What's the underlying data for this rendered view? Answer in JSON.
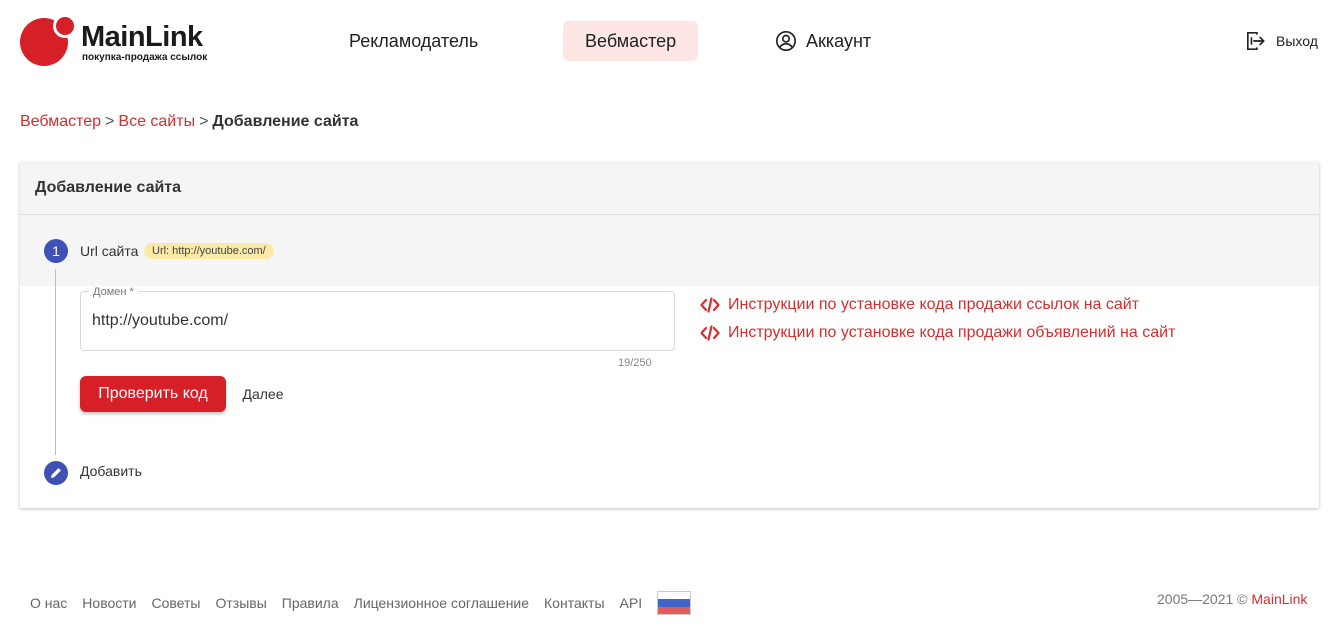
{
  "logo": {
    "name": "MainLink",
    "tagline": "покупка-продажа ссылок"
  },
  "nav": {
    "advertiser": "Рекламодатель",
    "webmaster": "Вебмастер",
    "account": "Аккаунт",
    "logout": "Выход"
  },
  "breadcrumb": {
    "items": [
      "Вебмастер",
      "Все сайты"
    ],
    "separator": ">",
    "current": "Добавление сайта"
  },
  "card": {
    "title": "Добавление сайта",
    "step1": {
      "number": "1",
      "label": "Url сайта",
      "chip": "Url: http://youtube.com/"
    },
    "field": {
      "label": "Домен *",
      "value": "http://youtube.com/",
      "counter": "19/250"
    },
    "buttons": {
      "check": "Проверить код",
      "next": "Далее"
    },
    "instructions": [
      "Инструкции по установке кода продажи ссылок на сайт",
      "Инструкции по установке кода продажи объявлений на сайт"
    ],
    "step2": {
      "label": "Добавить"
    }
  },
  "footer": {
    "links": [
      "О нас",
      "Новости",
      "Советы",
      "Отзывы",
      "Правила",
      "Лицензионное соглашение",
      "Контакты",
      "API"
    ],
    "flag_colors": [
      "#ffffff",
      "#3f66c8",
      "#e35b5b"
    ],
    "copyright_prefix": "2005—2021 ©",
    "copyright_brand": "MainLink"
  },
  "colors": {
    "accent": "#d61f26",
    "link": "#d32f2f",
    "step": "#3f51b5",
    "active_nav_bg": "#fde6e4",
    "chip_bg": "#fbe9a7"
  },
  "icons": {
    "account": "account-circle-icon",
    "logout": "logout-icon",
    "code": "code-icon",
    "edit": "pencil-icon"
  }
}
